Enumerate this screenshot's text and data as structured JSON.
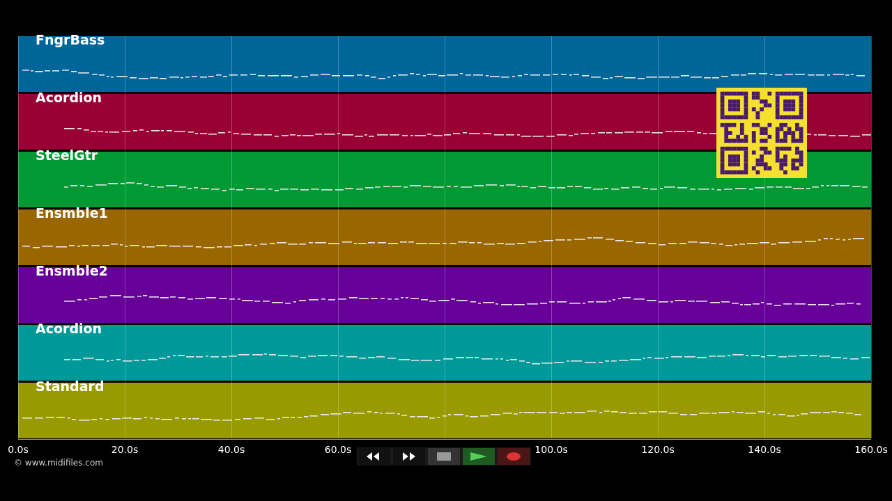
{
  "tracks": [
    {
      "name": "FngrBass",
      "color": "#006699"
    },
    {
      "name": "Acordion",
      "color": "#990033"
    },
    {
      "name": "SteelGtr",
      "color": "#009933"
    },
    {
      "name": "Ensmble1",
      "color": "#996600"
    },
    {
      "name": "Ensmble2",
      "color": "#660099"
    },
    {
      "name": "Acordion",
      "color": "#009999"
    },
    {
      "name": "Standard",
      "color": "#999900"
    }
  ],
  "time_axis": {
    "ticks": [
      {
        "kind": "labeled",
        "label": "0.0s"
      },
      {
        "kind": "labeled",
        "label": "20.0s"
      },
      {
        "kind": "labeled",
        "label": "40.0s"
      },
      {
        "kind": "labeled",
        "label": "60.0s"
      },
      {
        "kind": "hidden"
      },
      {
        "kind": "labeled",
        "label": "100.0s"
      },
      {
        "kind": "labeled",
        "label": "120.0s"
      },
      {
        "kind": "labeled",
        "label": "140.0s"
      },
      {
        "kind": "labeled",
        "label": "160.0s"
      }
    ]
  },
  "copyright": "© www.midifiles.com",
  "transport": [
    {
      "kind": "rewind"
    },
    {
      "kind": "forward"
    },
    {
      "kind": "stop"
    },
    {
      "kind": "play"
    },
    {
      "kind": "record"
    }
  ]
}
